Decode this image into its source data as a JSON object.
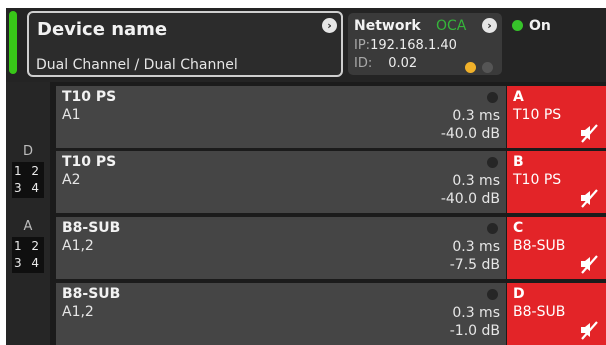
{
  "header": {
    "device": {
      "title": "Device name",
      "subtitle": "Dual Channel / Dual Channel"
    },
    "network": {
      "label": "Network",
      "protocol": "OCA",
      "ip_label": "IP:",
      "ip": "192.168.1.40",
      "id_label": "ID:",
      "id": "0.02"
    },
    "power": {
      "label": "On"
    }
  },
  "groups": [
    {
      "letter": "D",
      "nums": [
        "1 2",
        "3 4"
      ]
    },
    {
      "letter": "A",
      "nums": [
        "1 2",
        "3 4"
      ]
    }
  ],
  "rows": [
    {
      "name": "T10 PS",
      "source": "A1",
      "delay": "0.3 ms",
      "gain": "-40.0 dB"
    },
    {
      "name": "T10 PS",
      "source": "A2",
      "delay": "0.3 ms",
      "gain": "-40.0 dB"
    },
    {
      "name": "B8-SUB",
      "source": "A1,2",
      "delay": "0.3 ms",
      "gain": "-7.5 dB"
    },
    {
      "name": "B8-SUB",
      "source": "A1,2",
      "delay": "0.3 ms",
      "gain": "-1.0 dB"
    }
  ],
  "channels": [
    {
      "letter": "A",
      "name": "T10 PS",
      "icon": "speaker-muted-icon"
    },
    {
      "letter": "B",
      "name": "T10 PS",
      "icon": "speaker-muted-icon"
    },
    {
      "letter": "C",
      "name": "B8-SUB",
      "icon": "speaker-muted-icon"
    },
    {
      "letter": "D",
      "name": "B8-SUB",
      "icon": "speaker-muted-icon"
    }
  ],
  "colors": {
    "accent_green": "#38c718",
    "channel_red": "#e32428",
    "warning_amber": "#f0b12a"
  }
}
